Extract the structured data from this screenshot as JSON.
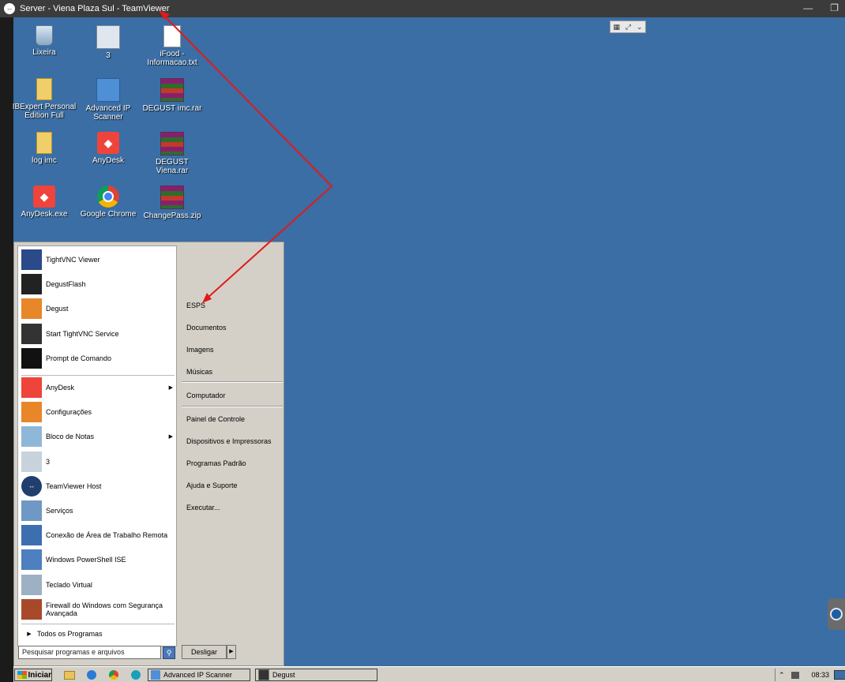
{
  "window": {
    "title": "Server - Viena Plaza Sul - TeamViewer",
    "min_glyph": "—",
    "restore_glyph": "❐"
  },
  "desktop_icons": [
    {
      "label": "Lixeira",
      "icon": "recycle-bin-icon"
    },
    {
      "label": "3",
      "icon": "shortcut-icon"
    },
    {
      "label": "iFood - Informacao.txt",
      "icon": "text-file-icon"
    },
    {
      "label": "IBExpert Personal Edition Full",
      "icon": "folder-icon"
    },
    {
      "label": "Advanced IP Scanner",
      "icon": "ip-scanner-icon"
    },
    {
      "label": "DEGUST imc.rar",
      "icon": "rar-archive-icon"
    },
    {
      "label": "log imc",
      "icon": "folder-icon"
    },
    {
      "label": "AnyDesk",
      "icon": "anydesk-icon"
    },
    {
      "label": "DEGUST Viena.rar",
      "icon": "rar-archive-icon"
    },
    {
      "label": "AnyDesk.exe",
      "icon": "anydesk-icon"
    },
    {
      "label": "Google Chrome",
      "icon": "chrome-icon"
    },
    {
      "label": "ChangePass.zip",
      "icon": "rar-archive-icon"
    }
  ],
  "start_menu": {
    "pinned": [
      {
        "label": "TightVNC Viewer",
        "icon": "tightvnc-icon"
      },
      {
        "label": "DegustFlash",
        "icon": "degustflash-icon"
      },
      {
        "label": "Degust",
        "icon": "degust-icon"
      },
      {
        "label": "Start TightVNC Service",
        "icon": "vnc-service-icon"
      },
      {
        "label": "Prompt de Comando",
        "icon": "command-prompt-icon"
      }
    ],
    "recent": [
      {
        "label": "AnyDesk",
        "icon": "anydesk-icon",
        "arrow": "▶"
      },
      {
        "label": "Configurações",
        "icon": "degust-config-icon"
      },
      {
        "label": "Bloco de Notas",
        "icon": "notepad-icon",
        "arrow": "▶"
      },
      {
        "label": "3",
        "icon": "shortcut-icon"
      },
      {
        "label": "TeamViewer Host",
        "icon": "teamviewer-icon"
      },
      {
        "label": "Serviços",
        "icon": "services-icon"
      },
      {
        "label": "Conexão de Área de Trabalho Remota",
        "icon": "remote-desktop-icon"
      },
      {
        "label": "Windows PowerShell ISE",
        "icon": "powershell-icon"
      },
      {
        "label": "Teclado Virtual",
        "icon": "keyboard-icon"
      },
      {
        "label": "Firewall do Windows com Segurança Avançada",
        "icon": "firewall-icon"
      }
    ],
    "all_programs": "Todos os Programas",
    "all_programs_arrow": "▶",
    "search_placeholder": "Pesquisar programas e arquivos",
    "right_items": {
      "group1": [
        "ESPS",
        "Documentos",
        "Imagens",
        "Músicas"
      ],
      "group2": [
        "Computador"
      ],
      "group3": [
        "Painel de Controle",
        "Dispositivos e Impressoras",
        "Programas Padrão",
        "Ajuda e Suporte",
        "Executar..."
      ]
    },
    "shutdown_label": "Desligar",
    "shutdown_arrow": "▶"
  },
  "taskbar": {
    "start_label": "Iniciar",
    "tasks": [
      "Advanced IP Scanner",
      "Degust"
    ],
    "tray_arrow": "⌃",
    "time": "08:33"
  },
  "colors": {
    "desktop": "#3a6ea5",
    "annotation_arrow": "#e01b1b"
  }
}
